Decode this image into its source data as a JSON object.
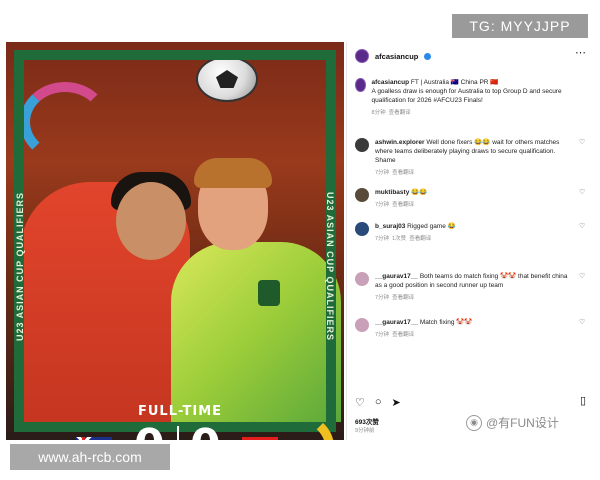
{
  "watermarks": {
    "tg": "TG: MYYJJPP",
    "site": "www.ah-rcb.com",
    "fun": "@有FUN设计"
  },
  "photo": {
    "side_text": "U23 ASIAN CUP QUALIFIERS",
    "full_time": "FULL-TIME",
    "home_score": "0",
    "away_score": "0",
    "home_team": "Australia",
    "away_team": "China PR"
  },
  "post": {
    "username": "afcasiancup",
    "caption": {
      "user": "afcasiancup",
      "tags": "FT | Australia 🇦🇺 China PR 🇨🇳",
      "text": "A goalless draw is enough for Australia to top Group D and secure qualification for 2026 #AFCU23 Finals!",
      "time": "8分钟",
      "translation": "查看翻译"
    },
    "comments": [
      {
        "user": "ashwin.explorer",
        "text": "Well done fixers 😂😂 wait for others matches where teams deliberately playing draws to secure qualification. Shame",
        "time": "7分钟",
        "action": "查看翻译",
        "avatar_color": "#3a3a3a"
      },
      {
        "user": "muktibasty",
        "text": "😂😂",
        "time": "7分钟",
        "action": "查看翻译",
        "avatar_color": "#5a4a3a"
      },
      {
        "user": "b_suraj03",
        "text": "Rigged game 😂",
        "time": "7分钟",
        "action": "1次赞",
        "extra": "查看翻译",
        "avatar_color": "#2a4a7a"
      },
      {
        "user": "__gaurav17__",
        "text": "Both teams do match fixing 🤡🤡 that benefit china as a good position in second runner up team",
        "time": "7分钟",
        "action": "查看翻译",
        "avatar_color": "#c8a0b8"
      },
      {
        "user": "__gaurav17__",
        "text": "Match fixing 🤡🤡",
        "time": "7分钟",
        "action": "查看翻译",
        "avatar_color": "#c8a0b8"
      }
    ],
    "likes": "693次赞",
    "date": "9分钟前"
  }
}
